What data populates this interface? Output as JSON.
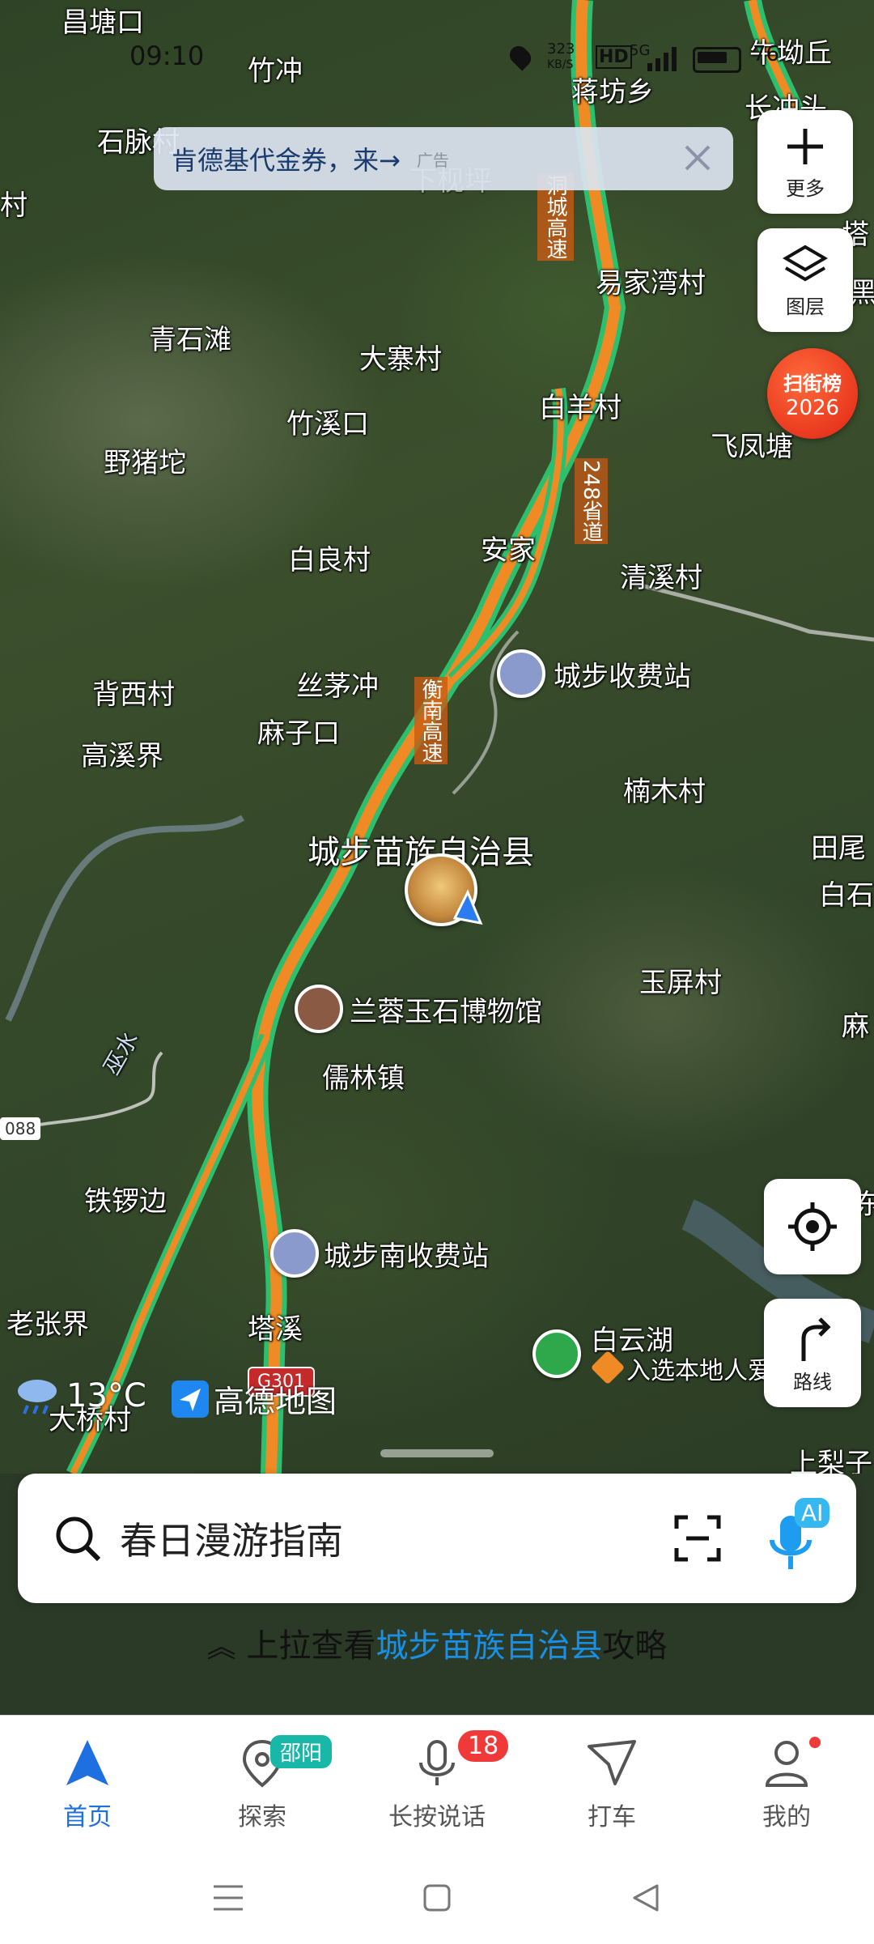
{
  "status_bar": {
    "time": "09:10",
    "network_speed": "323",
    "speed_unit": "KB/S",
    "hd": "HD",
    "signal": "5G",
    "battery": "76"
  },
  "ad_banner": {
    "text": "肯德基代金券，来→",
    "tag": "广告"
  },
  "map_labels": [
    {
      "name": "昌塘口"
    },
    {
      "name": "竹冲"
    },
    {
      "name": "石脉村"
    },
    {
      "name": "蒋坊乡"
    },
    {
      "name": "牛坳丘"
    },
    {
      "name": "长冲头"
    },
    {
      "name": "下枧坪"
    },
    {
      "name": "村"
    },
    {
      "name": "易家湾村"
    },
    {
      "name": "青石滩"
    },
    {
      "name": "大寨村"
    },
    {
      "name": "白羊村"
    },
    {
      "name": "竹溪口"
    },
    {
      "name": "飞凤塘"
    },
    {
      "name": "野猪坨"
    },
    {
      "name": "安家"
    },
    {
      "name": "白良村"
    },
    {
      "name": "清溪村"
    },
    {
      "name": "背西村"
    },
    {
      "name": "丝茅冲"
    },
    {
      "name": "城步收费站"
    },
    {
      "name": "麻子口"
    },
    {
      "name": "高溪界"
    },
    {
      "name": "楠木村"
    },
    {
      "name": "城步苗族自治县"
    },
    {
      "name": "田尾"
    },
    {
      "name": "白石"
    },
    {
      "name": "玉屏村"
    },
    {
      "name": "兰蓉玉石博物馆"
    },
    {
      "name": "麻"
    },
    {
      "name": "儒林镇"
    },
    {
      "name": "铁锣边"
    },
    {
      "name": "城步南收费站"
    },
    {
      "name": "老张界"
    },
    {
      "name": "塔溪"
    },
    {
      "name": "白云湖"
    },
    {
      "name": "入选本地人爱"
    },
    {
      "name": "大桥村"
    },
    {
      "name": "上梨子"
    },
    {
      "name": "塔"
    },
    {
      "name": "黑"
    },
    {
      "name": "东"
    }
  ],
  "road_labels": {
    "expressway_a": "洞城高速",
    "provincial_road": "248省道",
    "expressway_b": "衡南高速",
    "road_code": "088",
    "river": "巫水",
    "shield": "G301"
  },
  "side_buttons": {
    "more": "更多",
    "layers": "图层",
    "route": "路线"
  },
  "ranking_badge": {
    "line1": "扫街榜",
    "line2": "2026"
  },
  "weather": {
    "temp": "13°C"
  },
  "logo_text": "高德地图",
  "search": {
    "placeholder_text": "春日漫游指南",
    "ai": "AI"
  },
  "pull_hint": {
    "prefix": "上拉查看",
    "highlight": "城步苗族自治县",
    "suffix": "攻略"
  },
  "tabs": [
    {
      "label": "首页",
      "active": true
    },
    {
      "label": "探索",
      "badge": "邵阳"
    },
    {
      "label": "长按说话",
      "badge": "18"
    },
    {
      "label": "打车"
    },
    {
      "label": "我的"
    }
  ],
  "colors": {
    "accent": "#1e6fe0",
    "highlight": "#1a8fe6",
    "expressway": "#f08a24",
    "road_edge": "#2cc06e",
    "badge_red": "#f03a3a",
    "explore_badge": "#18b7a8"
  }
}
